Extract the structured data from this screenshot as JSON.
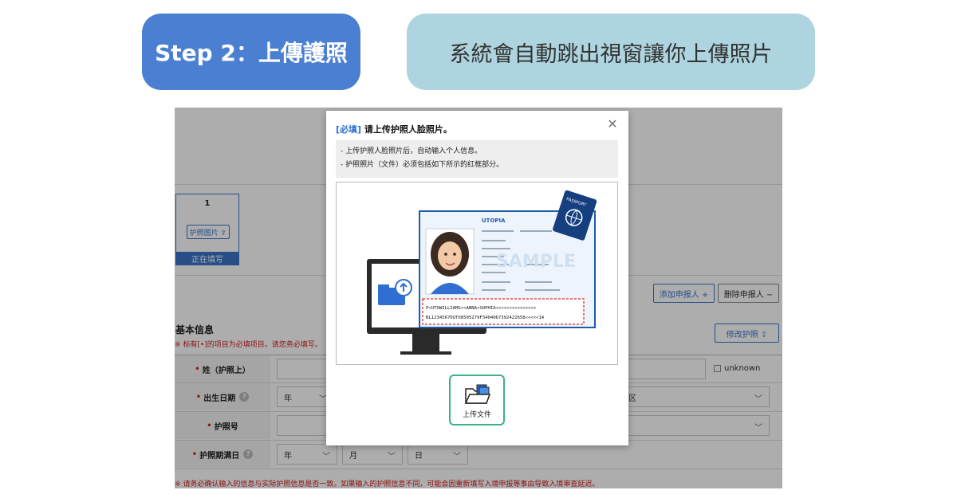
{
  "header": {
    "step_label": "Step 2：上傳護照",
    "description": "系統會自動跳出視窗讓你上傳照片"
  },
  "form": {
    "applicant_card": {
      "number": "1",
      "passport_photo_button": "护照图片 ⇪",
      "status": "正在填写"
    },
    "add_applicant_button": "添加申报人 +",
    "delete_applicant_button": "删除申报人 −",
    "section_title": "基本信息",
    "required_note": "※ 标有[•]的项目为必填项目。请您务必填写。",
    "edit_passport_button": "修改护照 ⇪",
    "fields": {
      "surname_label": "姓（护照上）",
      "unknown_label": "unknown",
      "birth_label": "出生日期",
      "birth_year": "年",
      "region_value": "区",
      "passport_no_label": "护照号",
      "expiry_label": "护照期满日",
      "expiry_year": "年",
      "expiry_month": "月",
      "expiry_day": "日"
    },
    "bottom_warning": "※ 请务必确认输入的信息与实际护照信息是否一致。如果输入的护照信息不同，可能会因重新填写入境申报等事由导致入境审查延迟。"
  },
  "modal": {
    "title_tag": "[必填]",
    "title_text": " 请上传护照人脸照片。",
    "info_lines": [
      "- 上传护照人脸照片后，自动输入个人信息。",
      "- 护照照片（文件）必须包括如下所示的红框部分。"
    ],
    "passport_sample": {
      "country": "UTOPIA",
      "watermark": "SAMPLE",
      "cover_text": "PASSPORT",
      "mrz_line1": "P<UTOWILLIAMS<<ANNA<SOPHIA<<<<<<<<<<<<<<<",
      "mrz_line2": "BL12345670UTO8505279F3404067392422658<<<<<14"
    },
    "upload_button": "上传文件"
  },
  "colors": {
    "step_pill": "#4a7fd1",
    "desc_pill": "#add4df",
    "accent_blue": "#3a74c9",
    "upload_border": "#3db38a",
    "warn_red": "#d62020"
  }
}
